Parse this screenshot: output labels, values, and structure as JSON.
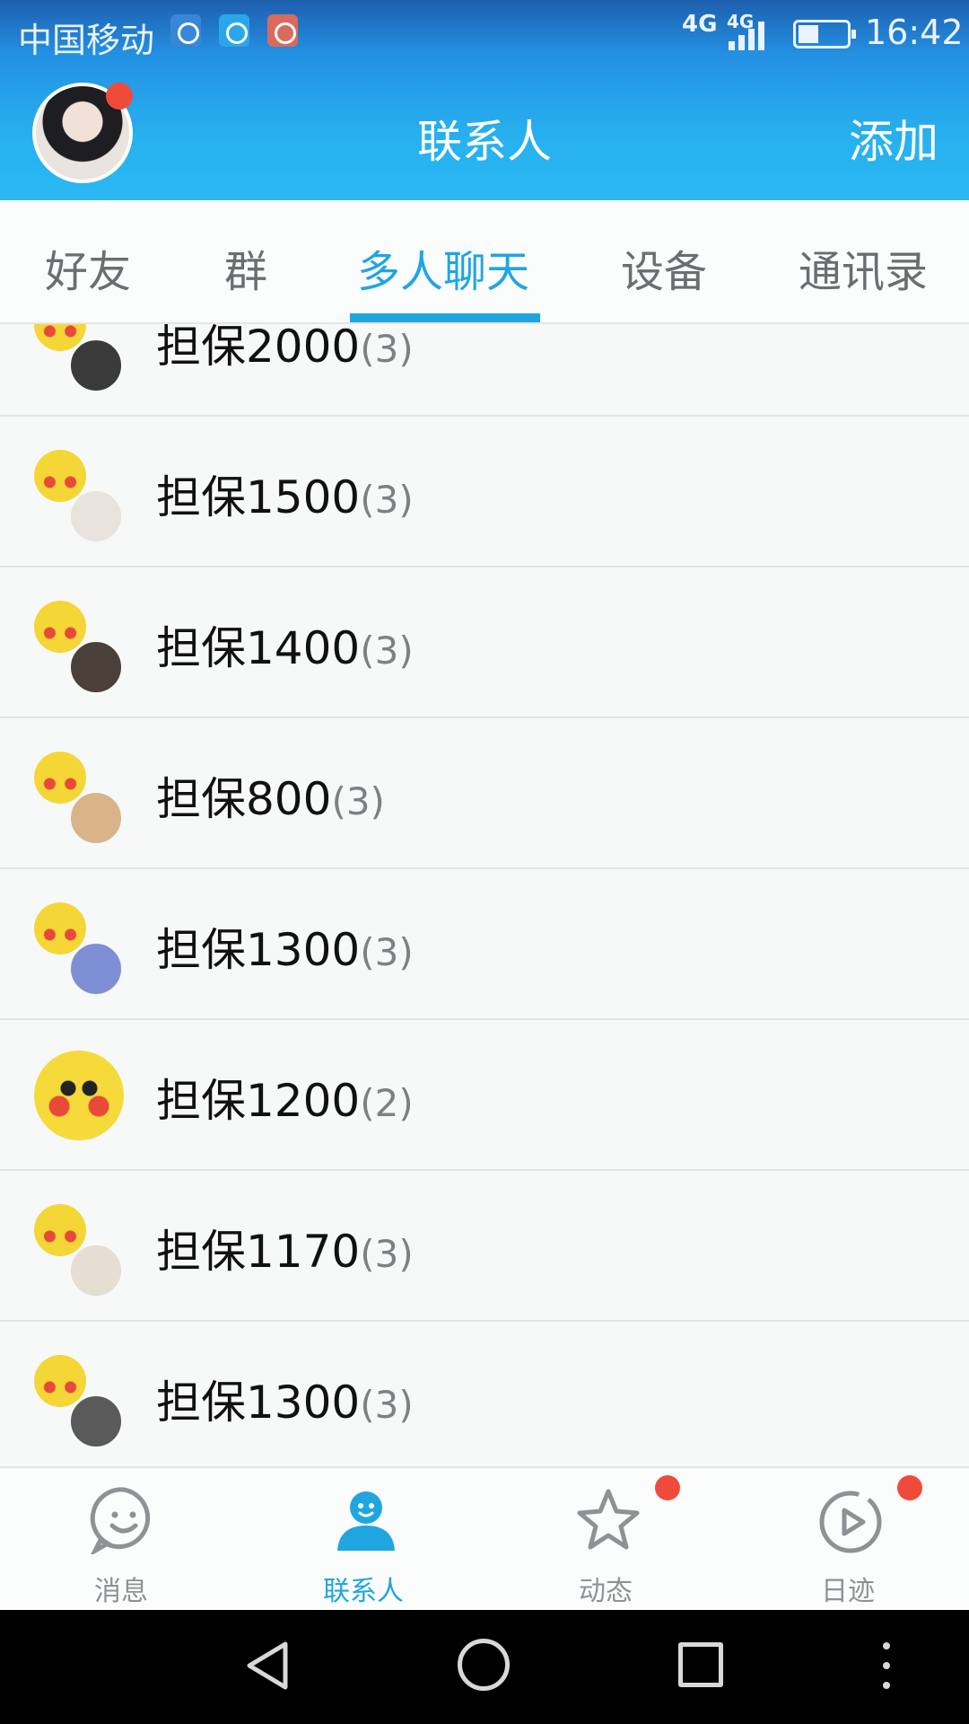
{
  "status_bar": {
    "carrier": "中国移动",
    "network_1": "4G",
    "network_2": "4G",
    "time": "16:42",
    "icons": [
      "health-app-icon",
      "message-app-icon",
      "app-notification-icon",
      "signal-icon",
      "battery-icon"
    ]
  },
  "header": {
    "title": "联系人",
    "add_label": "添加",
    "profile_badge": true
  },
  "tabs": [
    {
      "label": "好友",
      "active": false
    },
    {
      "label": "群",
      "active": false
    },
    {
      "label": "多人聊天",
      "active": true
    },
    {
      "label": "设备",
      "active": false
    },
    {
      "label": "通讯录",
      "active": false
    }
  ],
  "chats": [
    {
      "name": "担保2000",
      "count": "(3)",
      "avatar_front": "#3b3b3b"
    },
    {
      "name": "担保1500",
      "count": "(3)",
      "avatar_front": "#e8e3dc"
    },
    {
      "name": "担保1400",
      "count": "(3)",
      "avatar_front": "#4a4039"
    },
    {
      "name": "担保800",
      "count": "(3)",
      "avatar_front": "#d9b48a"
    },
    {
      "name": "担保1300",
      "count": "(3)",
      "avatar_front": "#7f8fd6"
    },
    {
      "name": "担保1200",
      "count": "(2)",
      "avatar_front": ""
    },
    {
      "name": "担保1170",
      "count": "(3)",
      "avatar_front": "#e6ddd3"
    },
    {
      "name": "担保1300",
      "count": "(3)",
      "avatar_front": "#5a5a5a"
    }
  ],
  "bottom_nav": [
    {
      "label": "消息",
      "icon": "smile-chat-icon",
      "active": false,
      "badge": false
    },
    {
      "label": "联系人",
      "icon": "contact-person-icon",
      "active": true,
      "badge": false
    },
    {
      "label": "动态",
      "icon": "star-icon",
      "active": false,
      "badge": true
    },
    {
      "label": "日迹",
      "icon": "play-circle-icon",
      "active": false,
      "badge": true
    }
  ],
  "colors": {
    "header": "#2ab8f2",
    "accent": "#1fa6e0",
    "badge": "#f04a3a",
    "inactive": "#8e9294"
  }
}
